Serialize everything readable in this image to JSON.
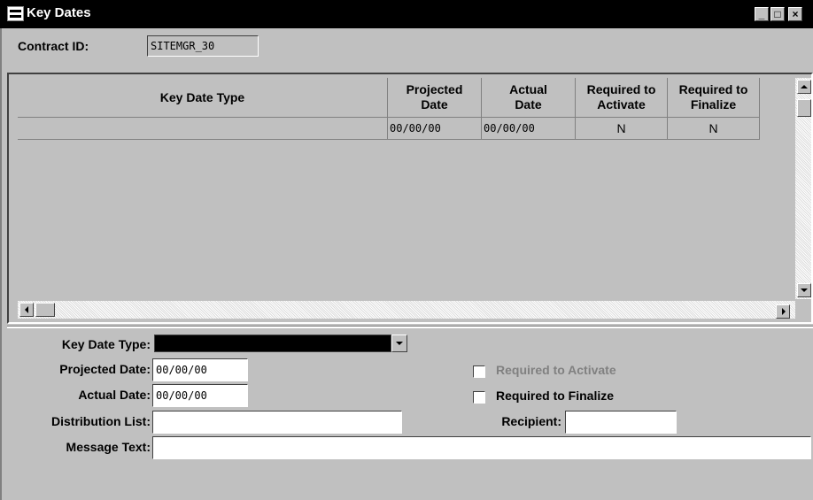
{
  "window": {
    "title": "Key Dates",
    "buttons": {
      "minimize": "_",
      "maximize": "□",
      "close": "×"
    }
  },
  "contract": {
    "label": "Contract ID:",
    "value": "SITEMGR_30"
  },
  "grid": {
    "headers": [
      "Key Date Type",
      "Projected Date",
      "Actual Date",
      "Required to Activate",
      "Required to Finalize"
    ],
    "rows": [
      {
        "key_date_type": "",
        "projected": "00/00/00",
        "actual": "00/00/00",
        "req_activate": "N",
        "req_finalize": "N"
      }
    ]
  },
  "form": {
    "key_date_type_label": "Key Date Type:",
    "key_date_type_value": "",
    "projected_label": "Projected Date:",
    "projected_value": "00/00/00",
    "actual_label": "Actual Date:",
    "actual_value": "00/00/00",
    "distribution_label": "Distribution List:",
    "distribution_value": "",
    "recipient_label": "Recipient:",
    "recipient_value": "",
    "message_label": "Message Text:",
    "message_value": "",
    "req_activate_label": "Required to Activate",
    "req_finalize_label": "Required to Finalize"
  }
}
